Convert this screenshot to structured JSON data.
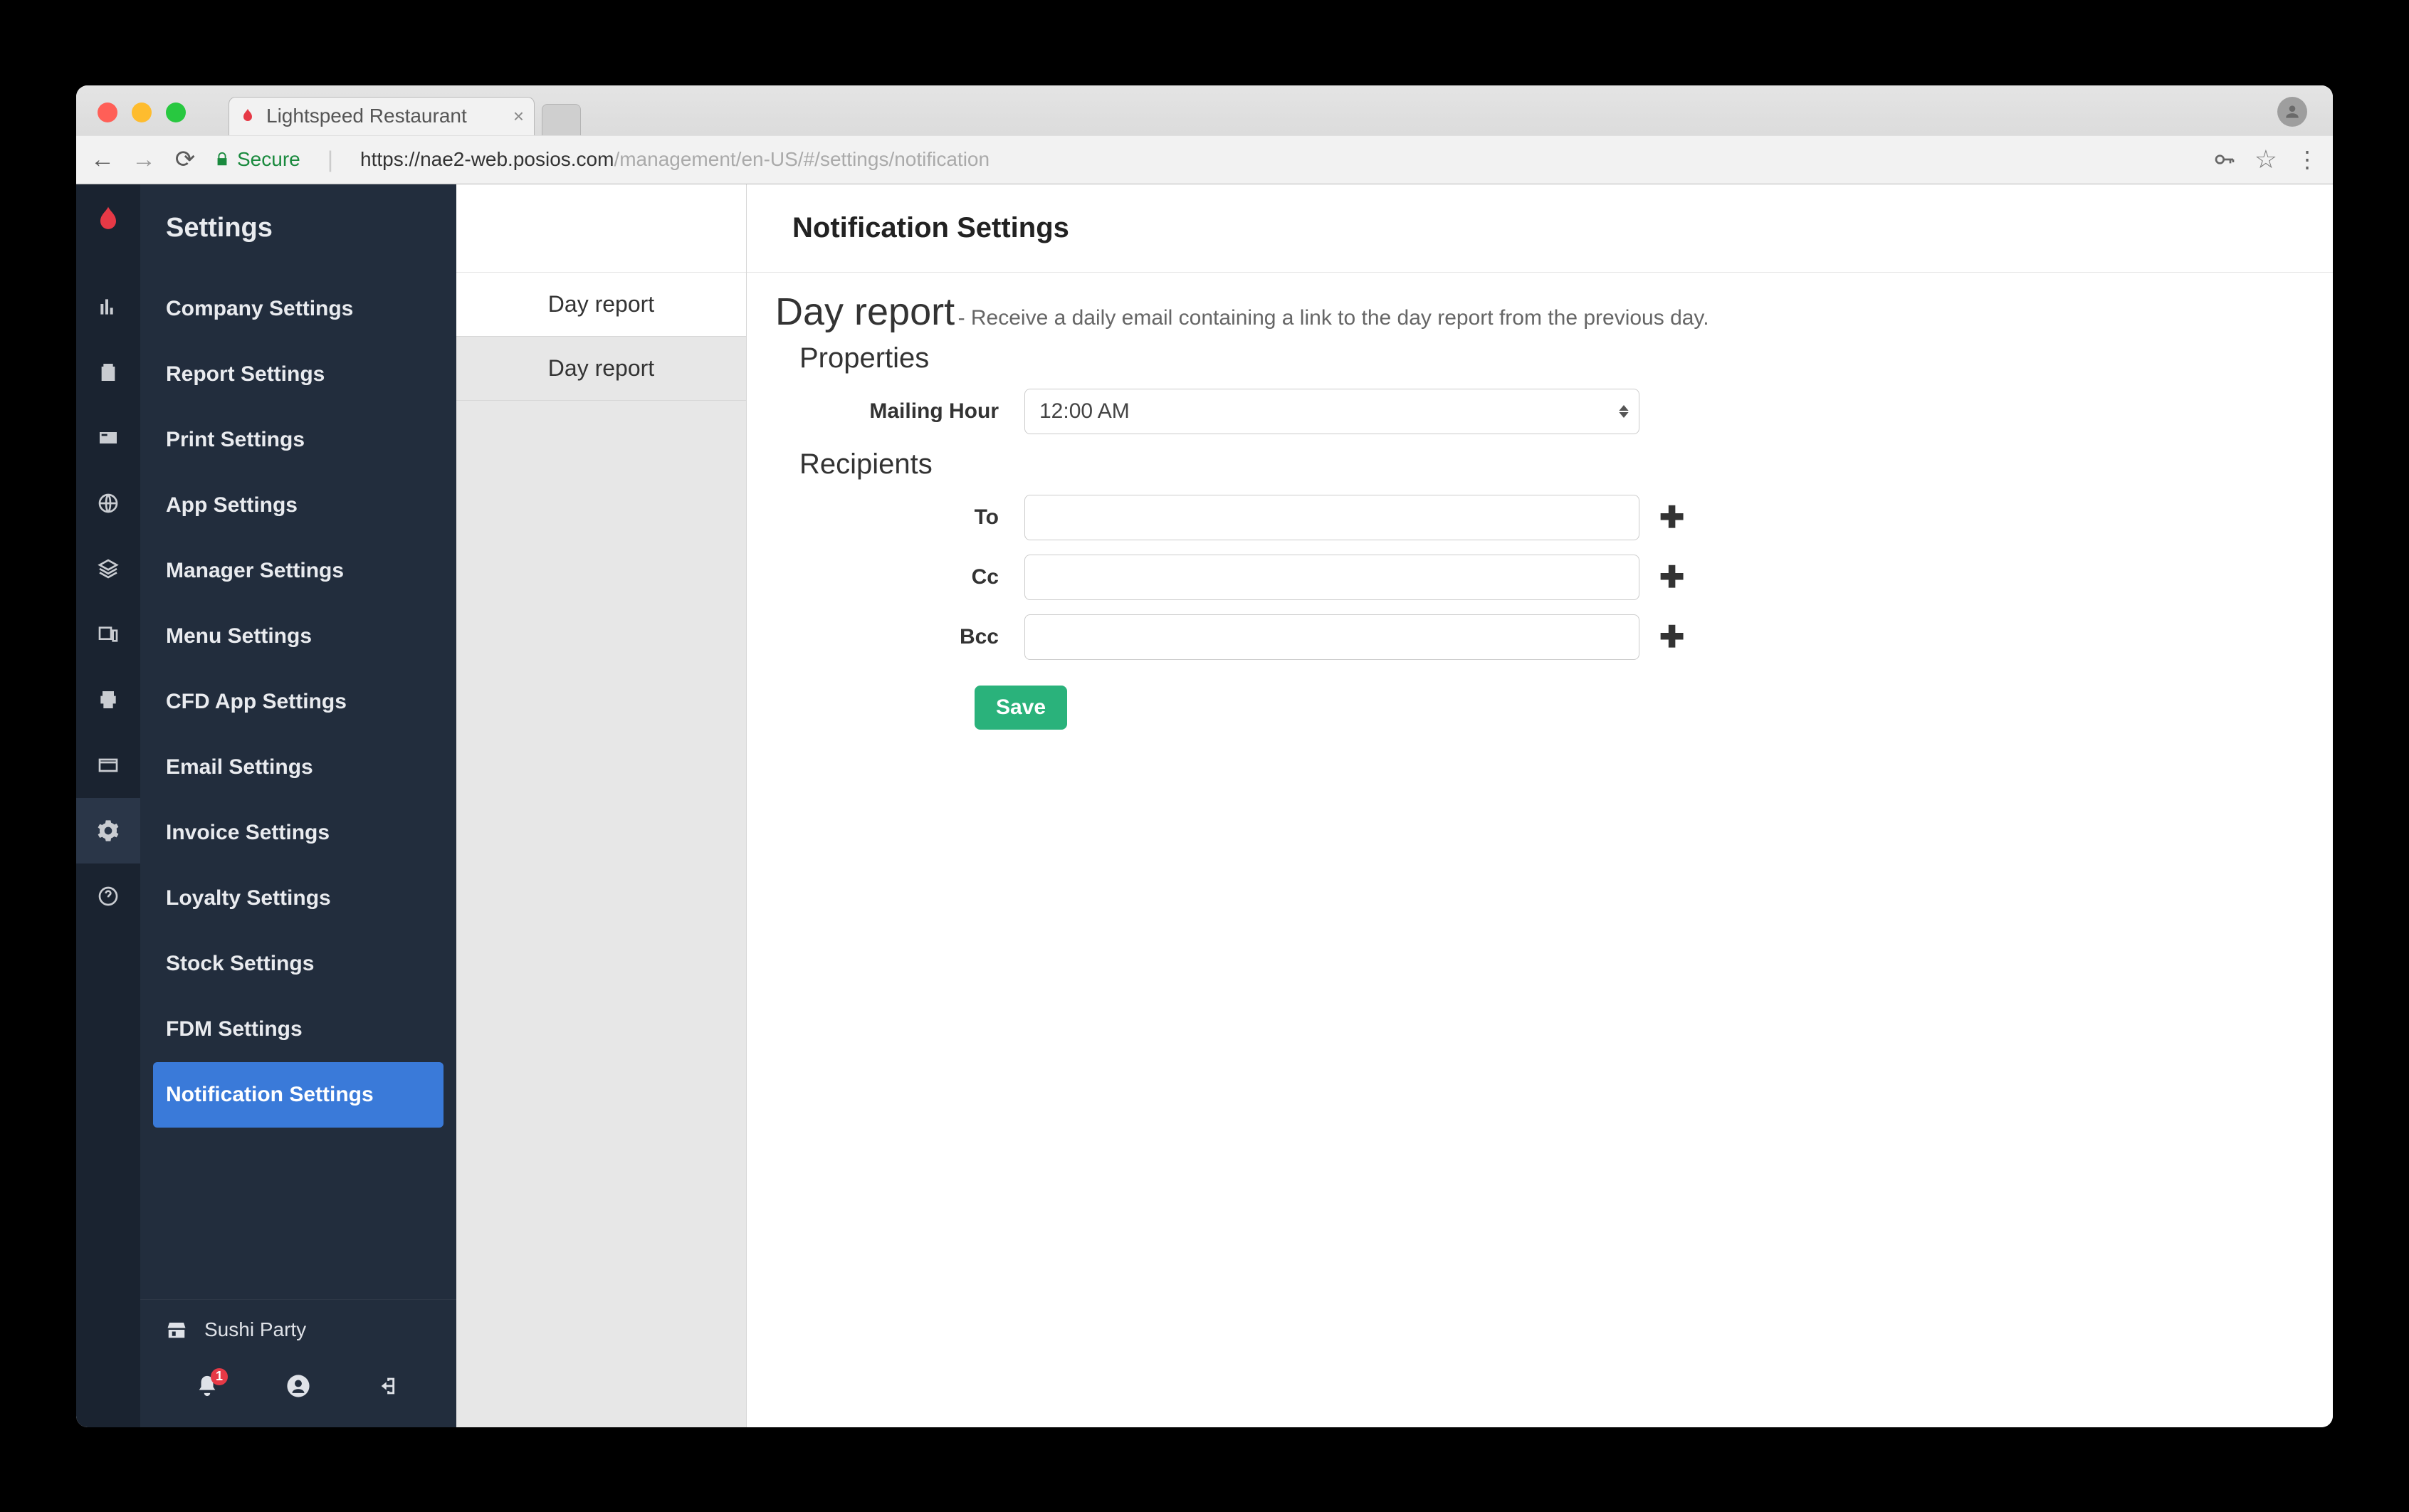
{
  "browser": {
    "tab_title": "Lightspeed Restaurant",
    "secure_label": "Secure",
    "url_prefix": "https://",
    "url_domain": "nae2-web.posios.com",
    "url_path": "/management/en-US/#/settings/notification"
  },
  "sidebar": {
    "title": "Settings",
    "items": [
      "Company Settings",
      "Report Settings",
      "Print Settings",
      "App Settings",
      "Manager Settings",
      "Menu Settings",
      "CFD App Settings",
      "Email Settings",
      "Invoice Settings",
      "Loyalty Settings",
      "Stock Settings",
      "FDM Settings",
      "Notification Settings"
    ],
    "establishment": "Sushi Party",
    "notif_count": "1"
  },
  "subnav": {
    "items": [
      "Day report",
      "Day report"
    ]
  },
  "content": {
    "header": "Notification Settings",
    "title": "Day report",
    "subtitle": " - Receive a daily email containing a link to the day report from the previous day.",
    "properties_label": "Properties",
    "mailing_hour_label": "Mailing Hour",
    "mailing_hour_value": "12:00 AM",
    "recipients_label": "Recipients",
    "to_label": "To",
    "cc_label": "Cc",
    "bcc_label": "Bcc",
    "to_value": "",
    "cc_value": "",
    "bcc_value": "",
    "save_label": "Save"
  }
}
